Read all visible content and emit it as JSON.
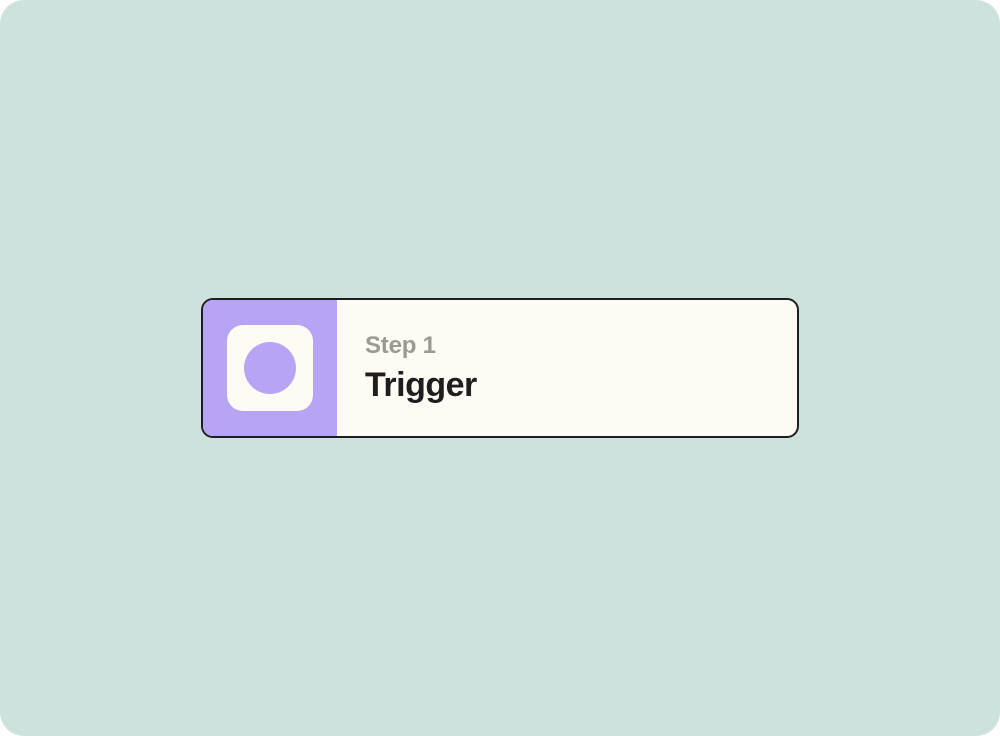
{
  "step": {
    "label": "Step 1",
    "title": "Trigger"
  },
  "colors": {
    "background": "#cde2dc",
    "card_bg": "#fdfbf3",
    "accent": "#b7a4f4",
    "border": "#1e1e1e",
    "muted_text": "#9a9a94",
    "title_text": "#1e1e1e"
  },
  "icon": {
    "name": "circle-icon"
  }
}
